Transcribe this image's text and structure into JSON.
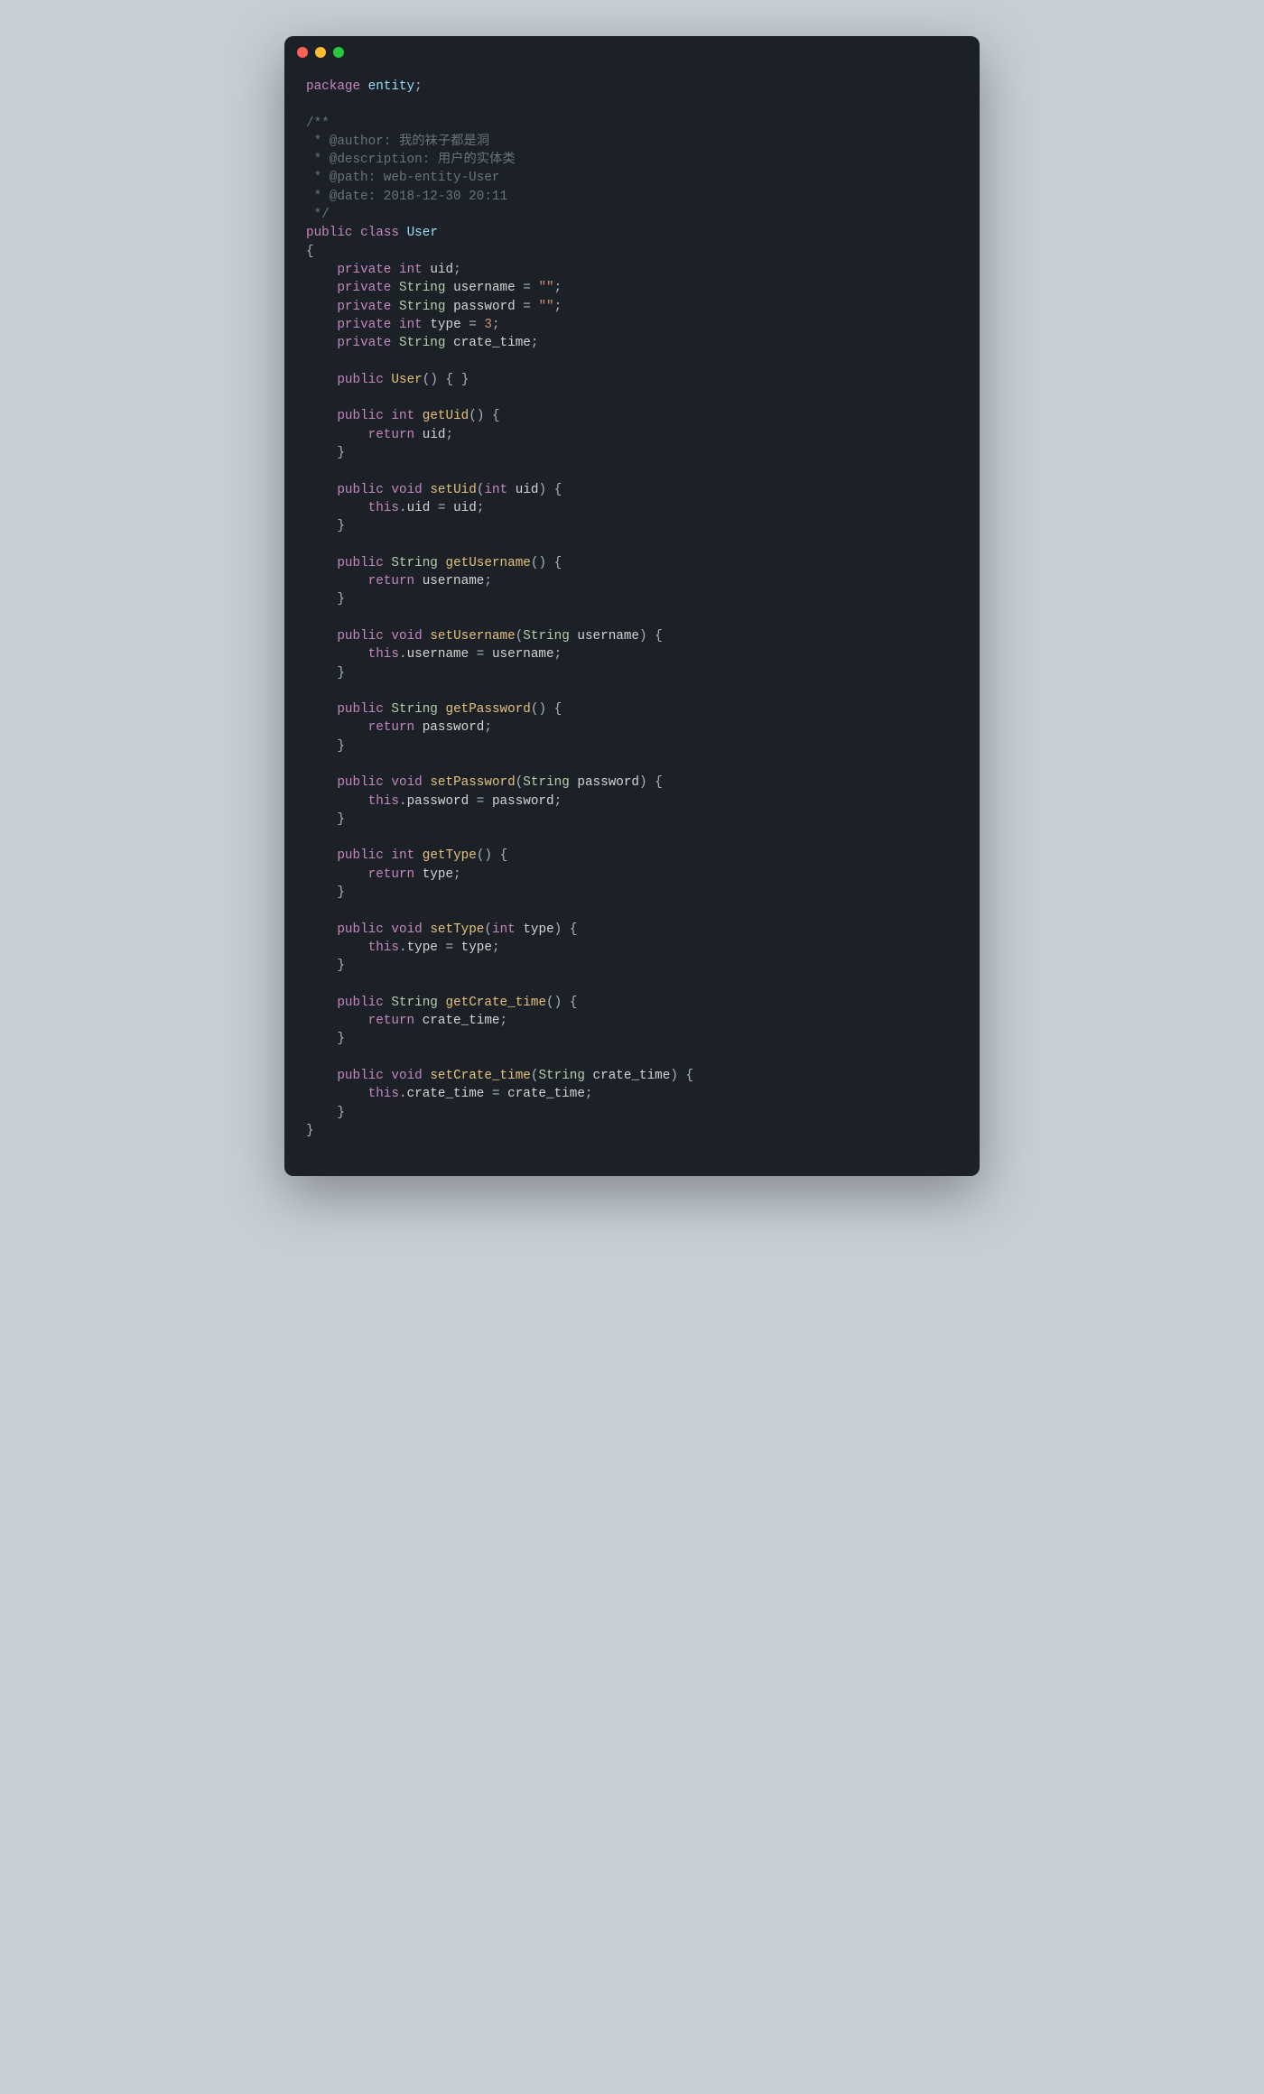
{
  "colors": {
    "background": "#c7ced6",
    "window": "#1c2128",
    "red": "#ff5f56",
    "yellow": "#ffbd2e",
    "green": "#27c93f"
  },
  "code": {
    "package_kw": "package",
    "package_name": "entity",
    "semi": ";",
    "comment": {
      "open": "/**",
      "author_tag": " * @author: ",
      "author_val": "我的袜子都是洞",
      "desc_tag": " * @description: ",
      "desc_val": "用户的实体类",
      "path_tag": " * @path: ",
      "path_val": "web-entity-User",
      "date_tag": " * @date: ",
      "date_val": "2018-12-30 20:11",
      "close": " */"
    },
    "public": "public",
    "class": "class",
    "classname": "User",
    "lbrace": "{",
    "rbrace": "}",
    "private": "private",
    "int": "int",
    "void": "void",
    "string": "String",
    "return": "return",
    "this": "this",
    "eq": " = ",
    "dot": ".",
    "lparen": "(",
    "rparen": ")",
    "empty_str": "\"\"",
    "three": "3",
    "fields": {
      "uid": "uid",
      "username": "username",
      "password": "password",
      "type": "type",
      "crate_time": "crate_time"
    },
    "methods": {
      "User": "User",
      "getUid": "getUid",
      "setUid": "setUid",
      "getUsername": "getUsername",
      "setUsername": "setUsername",
      "getPassword": "getPassword",
      "setPassword": "setPassword",
      "getType": "getType",
      "setType": "setType",
      "getCrate_time": "getCrate_time",
      "setCrate_time": "setCrate_time"
    }
  }
}
